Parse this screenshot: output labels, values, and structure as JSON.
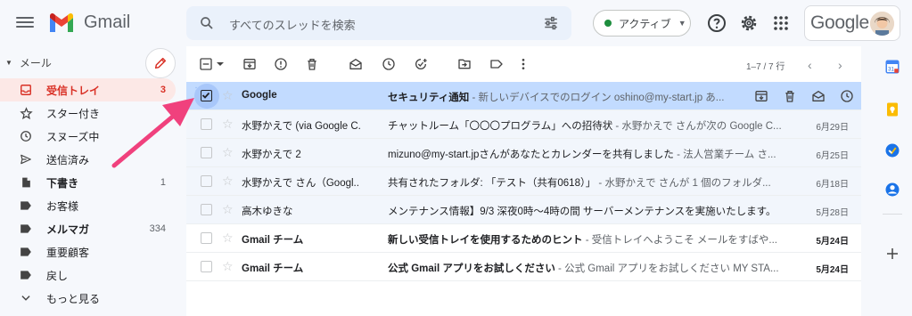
{
  "app": {
    "name": "Gmail"
  },
  "search": {
    "placeholder": "すべてのスレッドを検索"
  },
  "status": {
    "label": "アクティブ",
    "color": "#1e8e3e"
  },
  "account": {
    "google_label": "Google"
  },
  "sidebar": {
    "section_label": "メール",
    "items": [
      {
        "label": "受信トレイ",
        "count": "3",
        "icon": "inbox-icon"
      },
      {
        "label": "スター付き",
        "count": "",
        "icon": "star-icon"
      },
      {
        "label": "スヌーズ中",
        "count": "",
        "icon": "clock-icon"
      },
      {
        "label": "送信済み",
        "count": "",
        "icon": "send-icon"
      },
      {
        "label": "下書き",
        "count": "1",
        "icon": "draft-icon"
      },
      {
        "label": "お客様",
        "count": "",
        "icon": "label-icon"
      },
      {
        "label": "メルマガ",
        "count": "334",
        "icon": "label-icon"
      },
      {
        "label": "重要顧客",
        "count": "",
        "icon": "label-icon"
      },
      {
        "label": "戻し",
        "count": "",
        "icon": "label-icon"
      },
      {
        "label": "もっと見る",
        "count": "",
        "icon": "chevron-down-icon"
      }
    ]
  },
  "toolbar": {
    "pager": "1–7 / 7 行"
  },
  "emails": [
    {
      "sender": "Google",
      "subject": "セキュリティ通知",
      "snippet": " - 新しいデバイスでのログイン oshino@my-start.jp あ...",
      "date": "",
      "unread": true,
      "selected": true
    },
    {
      "sender": "水野かえで (via Google C.",
      "subject": "チャットルーム「〇〇〇プログラム」への招待状",
      "snippet": " - 水野かえで さんが次の Google C...",
      "date": "6月29日",
      "unread": false,
      "selected": false
    },
    {
      "sender": "水野かえで 2",
      "subject": "mizuno@my-start.jpさんがあなたとカレンダーを共有しました",
      "snippet": " - 法人営業チーム さ...",
      "date": "6月25日",
      "unread": false,
      "selected": false
    },
    {
      "sender": "水野かえで さん（Googl..",
      "subject": "共有されたフォルダ: 「テスト（共有0618）」",
      "snippet": " - 水野かえで さんが 1 個のフォルダ...",
      "date": "6月18日",
      "unread": false,
      "selected": false
    },
    {
      "sender": "高木ゆきな",
      "subject": "メンテナンス情報】9/3 深夜0時〜4時の間 サーバーメンテナンスを実施いたします。",
      "snippet": "",
      "date": "5月28日",
      "unread": false,
      "selected": false
    },
    {
      "sender": "Gmail チーム",
      "subject": "新しい受信トレイを使用するためのヒント",
      "snippet": " - 受信トレイへようこそ メールをすばや...",
      "date": "5月24日",
      "unread": true,
      "selected": false
    },
    {
      "sender": "Gmail チーム",
      "subject": "公式 Gmail アプリをお試しください",
      "snippet": " - 公式 Gmail アプリをお試しください MY STA...",
      "date": "5月24日",
      "unread": true,
      "selected": false
    }
  ],
  "colors": {
    "accent_red": "#d93025",
    "selected_row": "#c2dbff",
    "arrow": "#f0417d"
  }
}
